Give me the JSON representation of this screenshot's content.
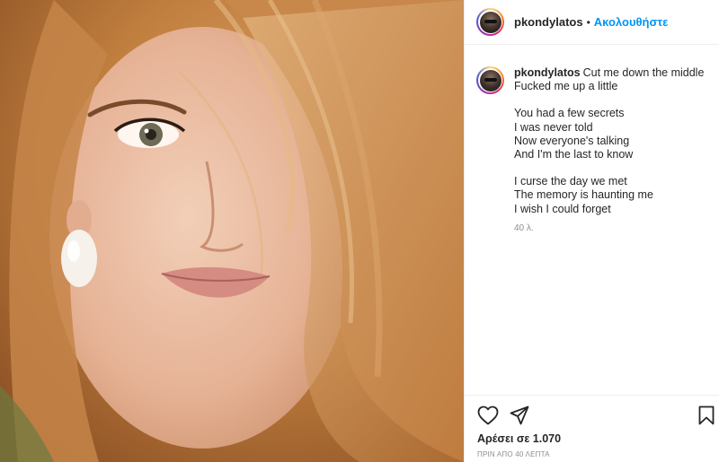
{
  "post": {
    "username": "pkondylatos",
    "header_separator": "•",
    "follow_label": "Ακολουθήστε"
  },
  "caption": {
    "username": "pkondylatos",
    "lines": [
      "Cut me down the middle",
      "Fucked me up a little",
      "",
      "You had a few secrets",
      "I was never told",
      "Now everyone's talking",
      "And I'm the last to know",
      "",
      "I curse the day we met",
      "The memory is haunting me",
      "I wish I could forget"
    ],
    "time": "40 λ."
  },
  "actions": {
    "like_icon": "heart-outline-icon",
    "share_icon": "paper-plane-icon",
    "save_icon": "bookmark-outline-icon",
    "likes_text": "Αρέσει σε 1.070",
    "post_time": "ΠΡΙΝ ΑΠΟ 40 ΛΕΠΤΑ"
  },
  "colors": {
    "link_blue": "#0095f6",
    "text": "#262626",
    "muted": "#8e8e8e",
    "border": "#efefef"
  }
}
